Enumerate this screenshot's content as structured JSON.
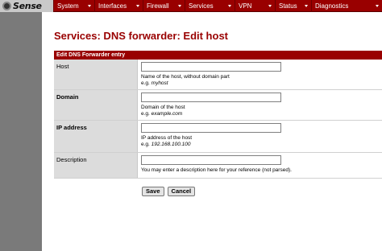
{
  "nav": {
    "logo_text": "Sense",
    "items": [
      {
        "label": "System"
      },
      {
        "label": "Interfaces"
      },
      {
        "label": "Firewall"
      },
      {
        "label": "Services"
      },
      {
        "label": "VPN"
      },
      {
        "label": "Status"
      },
      {
        "label": "Diagnostics"
      }
    ],
    "bar_color": "#990000"
  },
  "page": {
    "title": "Services: DNS forwarder: Edit host"
  },
  "form": {
    "section_title": "Edit DNS Forwarder entry",
    "fields": [
      {
        "label": "Host",
        "value": "",
        "hint": "Name of the host, without domain part",
        "example_prefix": "e.g. ",
        "example": "myhost"
      },
      {
        "label": "Domain",
        "value": "",
        "hint": "Domain of the host",
        "example_prefix": "e.g. ",
        "example": "example.com"
      },
      {
        "label": "IP address",
        "value": "",
        "hint": "IP address of the host",
        "example_prefix": "e.g. ",
        "example": "192.168.100.100"
      },
      {
        "label": "Description",
        "value": "",
        "hint": "You may enter a description here for your reference (not parsed)."
      }
    ],
    "save_label": "Save",
    "cancel_label": "Cancel"
  }
}
